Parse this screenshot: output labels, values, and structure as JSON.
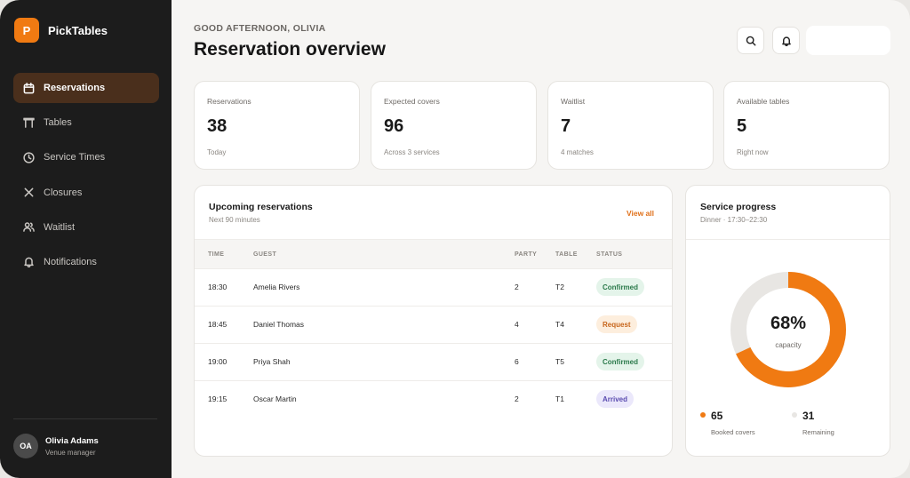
{
  "brand": {
    "logo_letter": "P",
    "name": "PickTables",
    "color": "#f07a12"
  },
  "sidebar": {
    "items": [
      {
        "label": "Reservations",
        "icon": "calendar-icon",
        "active": true
      },
      {
        "label": "Tables",
        "icon": "table-icon"
      },
      {
        "label": "Service Times",
        "icon": "clock-icon"
      },
      {
        "label": "Closures",
        "icon": "close-icon"
      },
      {
        "label": "Waitlist",
        "icon": "users-icon"
      },
      {
        "label": "Notifications",
        "icon": "bell-icon"
      }
    ],
    "user": {
      "initials": "OA",
      "name": "Olivia Adams",
      "role": "Venue manager"
    }
  },
  "header": {
    "greeting": "GOOD AFTERNOON, OLIVIA",
    "title": "Reservation overview",
    "search_icon": "search-icon",
    "notifications_icon": "bell-icon"
  },
  "stats": [
    {
      "label": "Reservations",
      "value": "38",
      "sub": "Today"
    },
    {
      "label": "Expected covers",
      "value": "96",
      "sub": "Across 3 services"
    },
    {
      "label": "Waitlist",
      "value": "7",
      "sub": "4 matches"
    },
    {
      "label": "Available tables",
      "value": "5",
      "sub": "Right now"
    }
  ],
  "upcoming": {
    "title": "Upcoming reservations",
    "subtitle": "Next 90 minutes",
    "view_all": "View all",
    "columns": [
      "TIME",
      "GUEST",
      "PARTY",
      "TABLE",
      "STATUS"
    ],
    "rows": [
      {
        "time": "18:30",
        "guest": "Amelia Rivers",
        "party": "2",
        "table": "T2",
        "status": "Confirmed"
      },
      {
        "time": "18:45",
        "guest": "Daniel Thomas",
        "party": "4",
        "table": "T4",
        "status": "Request"
      },
      {
        "time": "19:00",
        "guest": "Priya Shah",
        "party": "6",
        "table": "T5",
        "status": "Confirmed"
      },
      {
        "time": "19:15",
        "guest": "Oscar Martin",
        "party": "2",
        "table": "T1",
        "status": "Arrived"
      }
    ],
    "status_colors": {
      "Confirmed": {
        "bg": "#e4f4ea",
        "fg": "#2b7a4b"
      },
      "Request": {
        "bg": "#fdeedd",
        "fg": "#c7651b"
      },
      "Arrived": {
        "bg": "#ebe8fb",
        "fg": "#5a4bb0"
      }
    }
  },
  "service": {
    "title": "Service progress",
    "subtitle": "Dinner · 17:30–22:30",
    "percent_label": "68%",
    "percent": 68,
    "percent_caption": "capacity",
    "booked_value": "65",
    "booked_label": "Booked covers",
    "remaining_value": "31",
    "remaining_label": "Remaining",
    "accent": "#f07a12",
    "track": "#e8e6e3"
  }
}
